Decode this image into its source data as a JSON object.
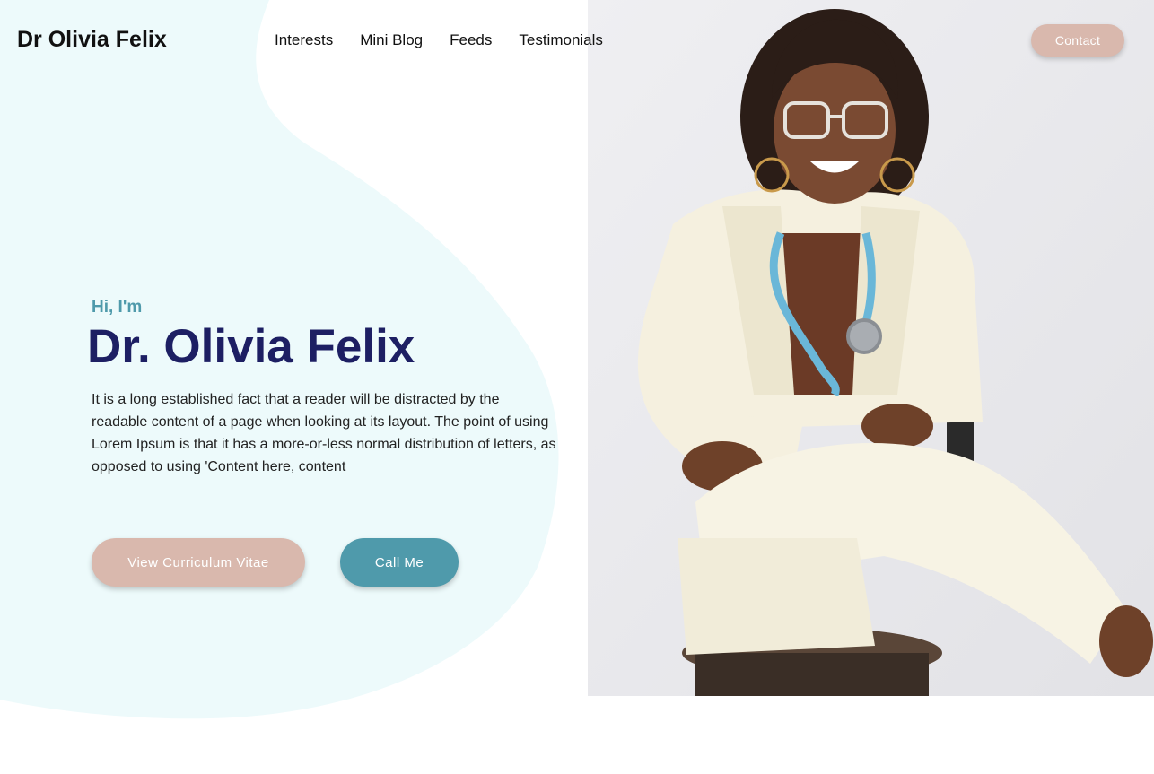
{
  "header": {
    "brand": "Dr Olivia Felix",
    "nav": [
      "Interests",
      "Mini Blog",
      "Feeds",
      "Testimonials"
    ],
    "contact_label": "Contact"
  },
  "hero": {
    "greeting": "Hi, I'm",
    "name": "Dr. Olivia Felix",
    "description": "It is a long established fact that a reader will be distracted by the readable content of a page when looking at its layout. The point of using Lorem Ipsum is that it has a more-or-less normal distribution of letters, as opposed to using 'Content here, content",
    "cv_button": "View Curriculum Vitae",
    "call_button": "Call Me"
  },
  "colors": {
    "blob": "#edfafb",
    "accent_pink": "#d9b8ad",
    "accent_teal": "#4f9aab",
    "heading_navy": "#1d1f63"
  }
}
